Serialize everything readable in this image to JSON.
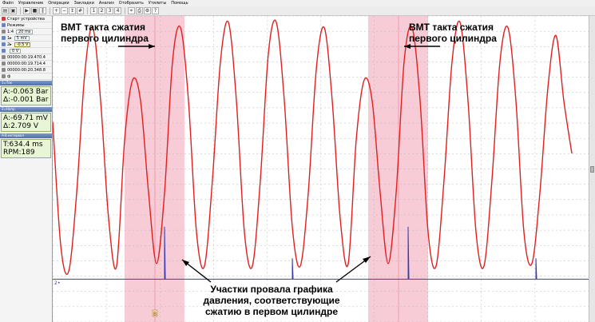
{
  "menu": [
    "Файл",
    "Управление",
    "Операции",
    "Закладки",
    "Анализ",
    "Отобразить",
    "Утилиты",
    "Помощь"
  ],
  "sidebar": {
    "rows": [
      {
        "label": "Старт устройства"
      },
      {
        "label": "Режимы"
      },
      {
        "label": "1:4",
        "value": "20 ms"
      },
      {
        "label": "1▸",
        "value": "5 mV"
      },
      {
        "label": "2▸",
        "value": "-0.5 V"
      },
      {
        "label": "",
        "value": "0 V"
      },
      {
        "label": "00000:00:19.470.4"
      },
      {
        "label": "00000:00:19.714.4"
      },
      {
        "label": "00000:00:20.348.8"
      },
      {
        "label": "ф"
      }
    ],
    "panels": [
      {
        "head": "1=Ток",
        "lines": [
          "A:-0.063 Bar",
          "Δ:-0.001 Bar"
        ]
      },
      {
        "head": "2=Напр.",
        "lines": [
          "A:-69.71 mV",
          "Δ:2.709 V"
        ]
      },
      {
        "head": "A-B интервал",
        "lines": [
          "T:634.4 ms",
          "RPM:189"
        ]
      }
    ]
  },
  "plot": {
    "channel_marker": "2•",
    "cursor_marker": "B",
    "annotations": {
      "top_left": [
        "ВМТ такта сжатия",
        "первого цилиндра"
      ],
      "top_right": [
        "ВМТ такта сжатия",
        "первого цилиндра"
      ],
      "bottom": [
        "Участки провала графика",
        "давления, соответствующие",
        "сжатию в первом цилиндре"
      ]
    },
    "colors": {
      "waveform": "#e02020",
      "ignition": "#3a3ab0",
      "highlight": "#f7c3d0",
      "cursor": "#ee9aaa"
    }
  },
  "chart_data": {
    "type": "line",
    "series": [
      {
        "values": [
          [
            0,
            0.62
          ],
          [
            10,
            0.15
          ],
          [
            20,
            0.05
          ],
          [
            30,
            0.35
          ],
          [
            40,
            0.8
          ],
          [
            50,
            0.98
          ],
          [
            60,
            0.7
          ],
          [
            70,
            0.25
          ],
          [
            80,
            0.07
          ],
          [
            90,
            0.55
          ],
          [
            100,
            0.78
          ],
          [
            110,
            0.7
          ],
          [
            120,
            0.35
          ],
          [
            130,
            0.08
          ],
          [
            140,
            0.35
          ],
          [
            150,
            0.85
          ],
          [
            160,
            0.98
          ],
          [
            170,
            0.7
          ],
          [
            180,
            0.2
          ],
          [
            190,
            0.07
          ],
          [
            200,
            0.4
          ],
          [
            210,
            0.85
          ],
          [
            220,
            1.0
          ],
          [
            230,
            0.7
          ],
          [
            240,
            0.2
          ],
          [
            250,
            0.07
          ],
          [
            260,
            0.4
          ],
          [
            270,
            0.88
          ],
          [
            280,
            1.0
          ],
          [
            290,
            0.7
          ],
          [
            300,
            0.22
          ],
          [
            310,
            0.07
          ],
          [
            320,
            0.35
          ],
          [
            330,
            0.82
          ],
          [
            340,
            0.98
          ],
          [
            350,
            0.7
          ],
          [
            360,
            0.25
          ],
          [
            370,
            0.08
          ],
          [
            380,
            0.55
          ],
          [
            390,
            0.78
          ],
          [
            400,
            0.7
          ],
          [
            410,
            0.35
          ],
          [
            420,
            0.08
          ],
          [
            430,
            0.35
          ],
          [
            440,
            0.85
          ],
          [
            450,
            0.98
          ],
          [
            460,
            0.7
          ],
          [
            470,
            0.2
          ],
          [
            480,
            0.07
          ],
          [
            490,
            0.4
          ],
          [
            500,
            0.85
          ],
          [
            510,
            1.0
          ],
          [
            520,
            0.7
          ],
          [
            530,
            0.2
          ],
          [
            540,
            0.07
          ],
          [
            550,
            0.4
          ],
          [
            560,
            0.85
          ],
          [
            570,
            0.98
          ],
          [
            580,
            0.7
          ],
          [
            590,
            0.2
          ],
          [
            600,
            0.08
          ],
          [
            610,
            0.35
          ],
          [
            620,
            0.75
          ],
          [
            630,
            0.95
          ],
          [
            640,
            0.7
          ],
          [
            650,
            0.5
          ]
        ]
      },
      {
        "values": [
          [
            0,
            0.02
          ],
          [
            140,
            0.02
          ],
          [
            140,
            0.22
          ],
          [
            141,
            0.02
          ],
          [
            300,
            0.02
          ],
          [
            300,
            0.1
          ],
          [
            301,
            0.02
          ],
          [
            445,
            0.02
          ],
          [
            445,
            0.22
          ],
          [
            446,
            0.02
          ],
          [
            605,
            0.02
          ],
          [
            605,
            0.1
          ],
          [
            606,
            0.02
          ],
          [
            671,
            0.02
          ]
        ]
      }
    ],
    "highlight_ranges": [
      [
        90,
        165
      ],
      [
        395,
        470
      ]
    ],
    "cursors": [
      128,
      433
    ],
    "xlim": [
      0,
      671
    ],
    "ylim": [
      0,
      1
    ],
    "grid": true
  }
}
